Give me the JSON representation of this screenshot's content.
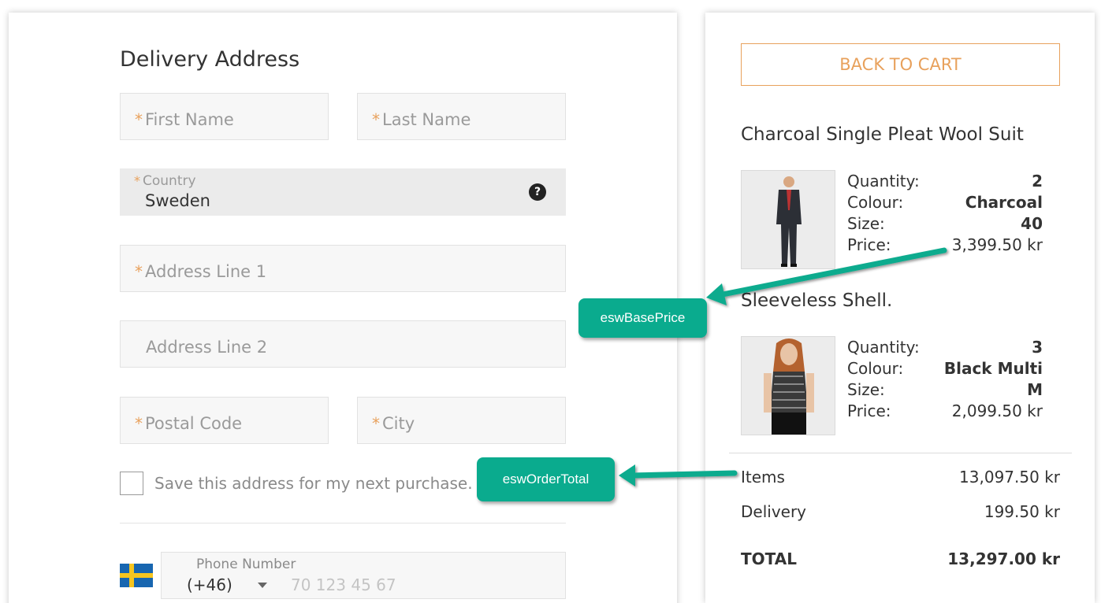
{
  "delivery": {
    "title": "Delivery Address",
    "required_mark": "*",
    "first_name": "First Name",
    "last_name": "Last Name",
    "country_label": "Country",
    "country_value": "Sweden",
    "help_icon": "?",
    "address1": "Address Line 1",
    "address2": "Address Line 2",
    "postal": "Postal Code",
    "city": "City",
    "save_label": "Save this address for my next purchase.",
    "phone_label": "Phone Number",
    "phone_code": "(+46)",
    "phone_placeholder": "70 123 45 67"
  },
  "cart": {
    "back_label": "BACK TO CART",
    "labels": {
      "quantity": "Quantity:",
      "colour": "Colour:",
      "size": "Size:",
      "price": "Price:"
    },
    "products": [
      {
        "name": "Charcoal Single Pleat Wool Suit",
        "quantity": "2",
        "colour": "Charcoal",
        "size": "40",
        "price": "3,399.50 kr"
      },
      {
        "name": "Sleeveless Shell.",
        "quantity": "3",
        "colour": "Black Multi",
        "size": "M",
        "price": "2,099.50 kr"
      }
    ],
    "summary": {
      "items_label": "Items",
      "items_value": "13,097.50 kr",
      "delivery_label": "Delivery",
      "delivery_value": "199.50 kr",
      "total_label": "TOTAL",
      "total_value": "13,297.00 kr"
    }
  },
  "callouts": {
    "base_price": "eswBasePrice",
    "order_total": "eswOrderTotal"
  },
  "colors": {
    "accent": "#e8a15c",
    "callout": "#0aab8e"
  }
}
